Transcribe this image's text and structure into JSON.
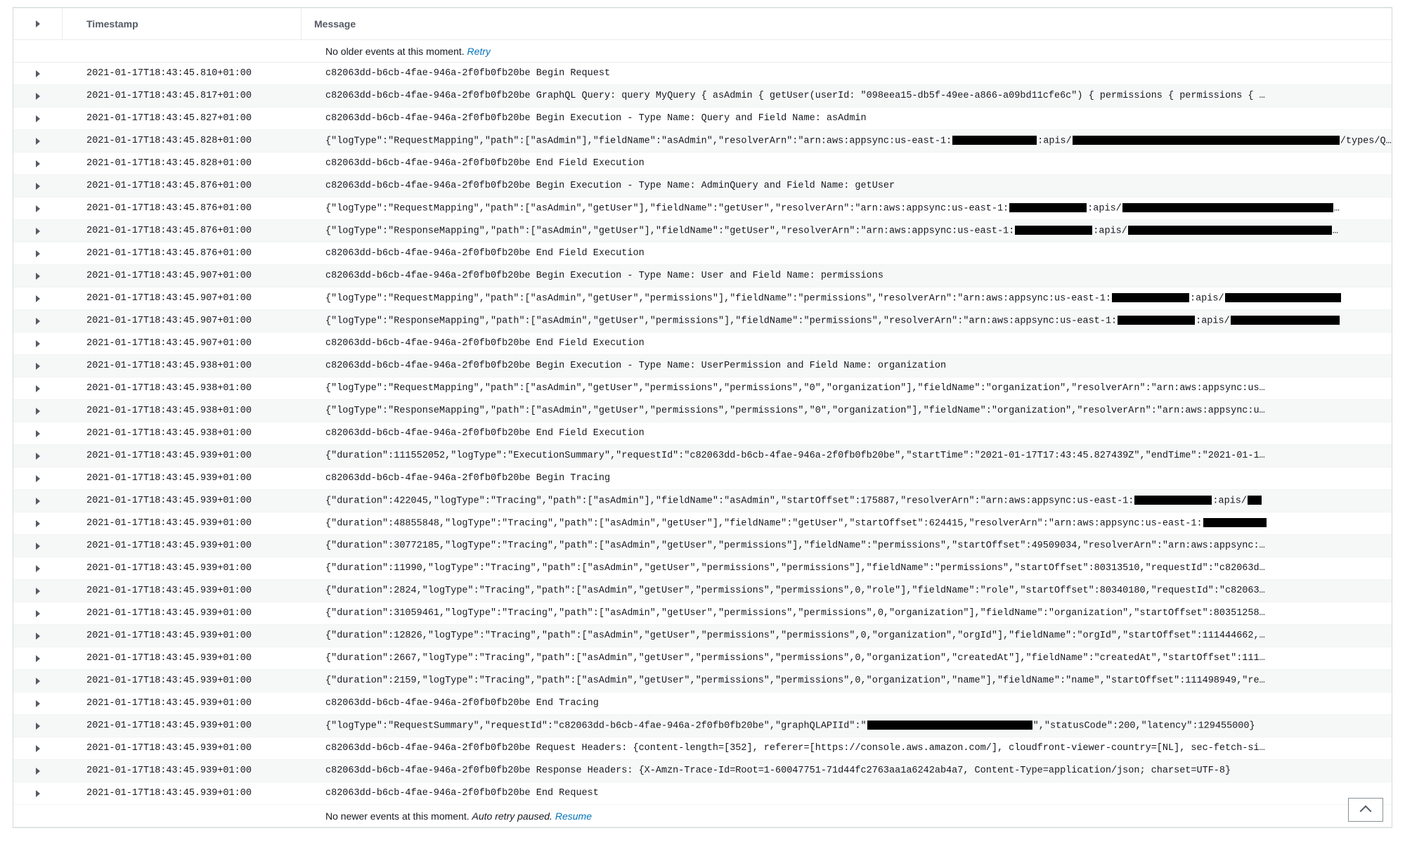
{
  "header": {
    "timestamp_label": "Timestamp",
    "message_label": "Message"
  },
  "older_notice": {
    "text": "No older events at this moment. ",
    "retry": "Retry"
  },
  "newer_notice": {
    "text": "No newer events at this moment. ",
    "auto": "Auto retry paused. ",
    "resume": "Resume"
  },
  "rows": [
    {
      "ts": "2021-01-17T18:43:45.810+01:00",
      "segments": [
        {
          "t": "c82063dd-b6cb-4fae-946a-2f0fb0fb20be Begin Request"
        }
      ]
    },
    {
      "ts": "2021-01-17T18:43:45.817+01:00",
      "segments": [
        {
          "t": "c82063dd-b6cb-4fae-946a-2f0fb0fb20be GraphQL Query: query MyQuery { asAdmin { getUser(userId: \"098eea15-db5f-49ee-a866-a09bd11cfe6c\") { permissions { permissions { …"
        }
      ]
    },
    {
      "ts": "2021-01-17T18:43:45.827+01:00",
      "segments": [
        {
          "t": "c82063dd-b6cb-4fae-946a-2f0fb0fb20be Begin Execution - Type Name: Query and Field Name: asAdmin"
        }
      ]
    },
    {
      "ts": "2021-01-17T18:43:45.828+01:00",
      "segments": [
        {
          "t": "{\"logType\":\"RequestMapping\",\"path\":[\"asAdmin\"],\"fieldName\":\"asAdmin\",\"resolverArn\":\"arn:aws:appsync:us-east-1:"
        },
        {
          "r": 120
        },
        {
          "t": ":apis/"
        },
        {
          "r": 380
        },
        {
          "t": "/types/Que…"
        }
      ]
    },
    {
      "ts": "2021-01-17T18:43:45.828+01:00",
      "segments": [
        {
          "t": "c82063dd-b6cb-4fae-946a-2f0fb0fb20be End Field Execution"
        }
      ]
    },
    {
      "ts": "2021-01-17T18:43:45.876+01:00",
      "segments": [
        {
          "t": "c82063dd-b6cb-4fae-946a-2f0fb0fb20be Begin Execution - Type Name: AdminQuery and Field Name: getUser"
        }
      ]
    },
    {
      "ts": "2021-01-17T18:43:45.876+01:00",
      "segments": [
        {
          "t": "{\"logType\":\"RequestMapping\",\"path\":[\"asAdmin\",\"getUser\"],\"fieldName\":\"getUser\",\"resolverArn\":\"arn:aws:appsync:us-east-1:"
        },
        {
          "r": 110
        },
        {
          "t": ":apis/"
        },
        {
          "r": 300
        },
        {
          "t": "…"
        }
      ]
    },
    {
      "ts": "2021-01-17T18:43:45.876+01:00",
      "segments": [
        {
          "t": "{\"logType\":\"ResponseMapping\",\"path\":[\"asAdmin\",\"getUser\"],\"fieldName\":\"getUser\",\"resolverArn\":\"arn:aws:appsync:us-east-1:"
        },
        {
          "r": 110
        },
        {
          "t": ":apis/"
        },
        {
          "r": 290
        },
        {
          "t": "…"
        }
      ]
    },
    {
      "ts": "2021-01-17T18:43:45.876+01:00",
      "segments": [
        {
          "t": "c82063dd-b6cb-4fae-946a-2f0fb0fb20be End Field Execution"
        }
      ]
    },
    {
      "ts": "2021-01-17T18:43:45.907+01:00",
      "segments": [
        {
          "t": "c82063dd-b6cb-4fae-946a-2f0fb0fb20be Begin Execution - Type Name: User and Field Name: permissions"
        }
      ]
    },
    {
      "ts": "2021-01-17T18:43:45.907+01:00",
      "segments": [
        {
          "t": "{\"logType\":\"RequestMapping\",\"path\":[\"asAdmin\",\"getUser\",\"permissions\"],\"fieldName\":\"permissions\",\"resolverArn\":\"arn:aws:appsync:us-east-1:"
        },
        {
          "r": 110
        },
        {
          "t": ":apis/"
        },
        {
          "r": 165
        }
      ]
    },
    {
      "ts": "2021-01-17T18:43:45.907+01:00",
      "segments": [
        {
          "t": "{\"logType\":\"ResponseMapping\",\"path\":[\"asAdmin\",\"getUser\",\"permissions\"],\"fieldName\":\"permissions\",\"resolverArn\":\"arn:aws:appsync:us-east-1:"
        },
        {
          "r": 110
        },
        {
          "t": ":apis/"
        },
        {
          "r": 155
        }
      ]
    },
    {
      "ts": "2021-01-17T18:43:45.907+01:00",
      "segments": [
        {
          "t": "c82063dd-b6cb-4fae-946a-2f0fb0fb20be End Field Execution"
        }
      ]
    },
    {
      "ts": "2021-01-17T18:43:45.938+01:00",
      "segments": [
        {
          "t": "c82063dd-b6cb-4fae-946a-2f0fb0fb20be Begin Execution - Type Name: UserPermission and Field Name: organization"
        }
      ]
    },
    {
      "ts": "2021-01-17T18:43:45.938+01:00",
      "segments": [
        {
          "t": "{\"logType\":\"RequestMapping\",\"path\":[\"asAdmin\",\"getUser\",\"permissions\",\"permissions\",\"0\",\"organization\"],\"fieldName\":\"organization\",\"resolverArn\":\"arn:aws:appsync:us…"
        }
      ]
    },
    {
      "ts": "2021-01-17T18:43:45.938+01:00",
      "segments": [
        {
          "t": "{\"logType\":\"ResponseMapping\",\"path\":[\"asAdmin\",\"getUser\",\"permissions\",\"permissions\",\"0\",\"organization\"],\"fieldName\":\"organization\",\"resolverArn\":\"arn:aws:appsync:u…"
        }
      ]
    },
    {
      "ts": "2021-01-17T18:43:45.938+01:00",
      "segments": [
        {
          "t": "c82063dd-b6cb-4fae-946a-2f0fb0fb20be End Field Execution"
        }
      ]
    },
    {
      "ts": "2021-01-17T18:43:45.939+01:00",
      "segments": [
        {
          "t": "{\"duration\":111552052,\"logType\":\"ExecutionSummary\",\"requestId\":\"c82063dd-b6cb-4fae-946a-2f0fb0fb20be\",\"startTime\":\"2021-01-17T17:43:45.827439Z\",\"endTime\":\"2021-01-1…"
        }
      ]
    },
    {
      "ts": "2021-01-17T18:43:45.939+01:00",
      "segments": [
        {
          "t": "c82063dd-b6cb-4fae-946a-2f0fb0fb20be Begin Tracing"
        }
      ]
    },
    {
      "ts": "2021-01-17T18:43:45.939+01:00",
      "segments": [
        {
          "t": "{\"duration\":422045,\"logType\":\"Tracing\",\"path\":[\"asAdmin\"],\"fieldName\":\"asAdmin\",\"startOffset\":175887,\"resolverArn\":\"arn:aws:appsync:us-east-1:"
        },
        {
          "r": 110
        },
        {
          "t": ":apis/"
        },
        {
          "r": 20
        }
      ]
    },
    {
      "ts": "2021-01-17T18:43:45.939+01:00",
      "segments": [
        {
          "t": "{\"duration\":48855848,\"logType\":\"Tracing\",\"path\":[\"asAdmin\",\"getUser\"],\"fieldName\":\"getUser\",\"startOffset\":624415,\"resolverArn\":\"arn:aws:appsync:us-east-1:"
        },
        {
          "r": 90
        }
      ]
    },
    {
      "ts": "2021-01-17T18:43:45.939+01:00",
      "segments": [
        {
          "t": "{\"duration\":30772185,\"logType\":\"Tracing\",\"path\":[\"asAdmin\",\"getUser\",\"permissions\"],\"fieldName\":\"permissions\",\"startOffset\":49509034,\"resolverArn\":\"arn:aws:appsync:…"
        }
      ]
    },
    {
      "ts": "2021-01-17T18:43:45.939+01:00",
      "segments": [
        {
          "t": "{\"duration\":11990,\"logType\":\"Tracing\",\"path\":[\"asAdmin\",\"getUser\",\"permissions\",\"permissions\"],\"fieldName\":\"permissions\",\"startOffset\":80313510,\"requestId\":\"c82063d…"
        }
      ]
    },
    {
      "ts": "2021-01-17T18:43:45.939+01:00",
      "segments": [
        {
          "t": "{\"duration\":2824,\"logType\":\"Tracing\",\"path\":[\"asAdmin\",\"getUser\",\"permissions\",\"permissions\",0,\"role\"],\"fieldName\":\"role\",\"startOffset\":80340180,\"requestId\":\"c82063…"
        }
      ]
    },
    {
      "ts": "2021-01-17T18:43:45.939+01:00",
      "segments": [
        {
          "t": "{\"duration\":31059461,\"logType\":\"Tracing\",\"path\":[\"asAdmin\",\"getUser\",\"permissions\",\"permissions\",0,\"organization\"],\"fieldName\":\"organization\",\"startOffset\":80351258…"
        }
      ]
    },
    {
      "ts": "2021-01-17T18:43:45.939+01:00",
      "segments": [
        {
          "t": "{\"duration\":12826,\"logType\":\"Tracing\",\"path\":[\"asAdmin\",\"getUser\",\"permissions\",\"permissions\",0,\"organization\",\"orgId\"],\"fieldName\":\"orgId\",\"startOffset\":111444662,…"
        }
      ]
    },
    {
      "ts": "2021-01-17T18:43:45.939+01:00",
      "segments": [
        {
          "t": "{\"duration\":2667,\"logType\":\"Tracing\",\"path\":[\"asAdmin\",\"getUser\",\"permissions\",\"permissions\",0,\"organization\",\"createdAt\"],\"fieldName\":\"createdAt\",\"startOffset\":111…"
        }
      ]
    },
    {
      "ts": "2021-01-17T18:43:45.939+01:00",
      "segments": [
        {
          "t": "{\"duration\":2159,\"logType\":\"Tracing\",\"path\":[\"asAdmin\",\"getUser\",\"permissions\",\"permissions\",0,\"organization\",\"name\"],\"fieldName\":\"name\",\"startOffset\":111498949,\"re…"
        }
      ]
    },
    {
      "ts": "2021-01-17T18:43:45.939+01:00",
      "segments": [
        {
          "t": "c82063dd-b6cb-4fae-946a-2f0fb0fb20be End Tracing"
        }
      ]
    },
    {
      "ts": "2021-01-17T18:43:45.939+01:00",
      "segments": [
        {
          "t": "{\"logType\":\"RequestSummary\",\"requestId\":\"c82063dd-b6cb-4fae-946a-2f0fb0fb20be\",\"graphQLAPIId\":\""
        },
        {
          "r": 235
        },
        {
          "t": "\",\"statusCode\":200,\"latency\":129455000}"
        }
      ]
    },
    {
      "ts": "2021-01-17T18:43:45.939+01:00",
      "segments": [
        {
          "t": "c82063dd-b6cb-4fae-946a-2f0fb0fb20be Request Headers: {content-length=[352], referer=[https://console.aws.amazon.com/], cloudfront-viewer-country=[NL], sec-fetch-si…"
        }
      ]
    },
    {
      "ts": "2021-01-17T18:43:45.939+01:00",
      "segments": [
        {
          "t": "c82063dd-b6cb-4fae-946a-2f0fb0fb20be Response Headers: {X-Amzn-Trace-Id=Root=1-60047751-71d44fc2763aa1a6242ab4a7, Content-Type=application/json; charset=UTF-8}"
        }
      ]
    },
    {
      "ts": "2021-01-17T18:43:45.939+01:00",
      "segments": [
        {
          "t": "c82063dd-b6cb-4fae-946a-2f0fb0fb20be End Request"
        }
      ]
    }
  ]
}
